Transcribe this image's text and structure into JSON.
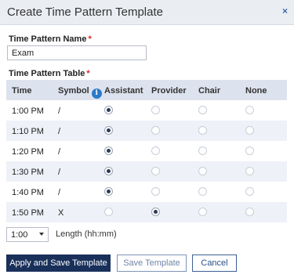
{
  "dialog": {
    "title": "Create Time Pattern Template",
    "close_label": "×"
  },
  "name_field": {
    "label": "Time Pattern Name",
    "required_mark": "*",
    "value": "Exam"
  },
  "table_section": {
    "label": "Time Pattern Table",
    "required_mark": "*"
  },
  "table": {
    "headers": [
      "Time",
      "Symbol",
      "Assistant",
      "Provider",
      "Chair",
      "None"
    ],
    "info_icon": "i",
    "rows": [
      {
        "time": "1:00 PM",
        "symbol": "/",
        "selected": "Assistant"
      },
      {
        "time": "1:10 PM",
        "symbol": "/",
        "selected": "Assistant"
      },
      {
        "time": "1:20 PM",
        "symbol": "/",
        "selected": "Assistant"
      },
      {
        "time": "1:30 PM",
        "symbol": "/",
        "selected": "Assistant"
      },
      {
        "time": "1:40 PM",
        "symbol": "/",
        "selected": "Assistant"
      },
      {
        "time": "1:50 PM",
        "symbol": "X",
        "selected": "Provider"
      }
    ]
  },
  "length": {
    "value": "1:00",
    "label": "Length (hh:mm)"
  },
  "buttons": {
    "apply_save": "Apply and Save Template",
    "save": "Save Template",
    "cancel": "Cancel"
  },
  "colors": {
    "header_bg": "#eaedf2",
    "primary": "#19305a",
    "alt_row": "#eef1f7",
    "required": "#dd2222",
    "info_icon": "#2b7bc9"
  }
}
